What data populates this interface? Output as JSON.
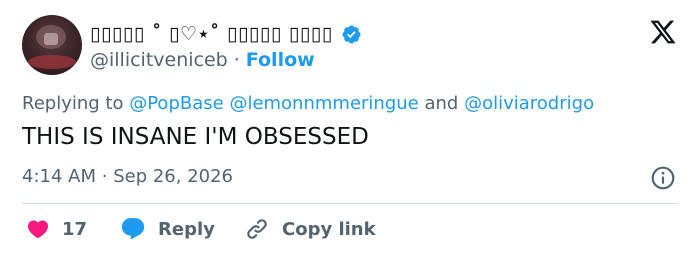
{
  "post": {
    "author": {
      "display_name": "▯▯▯▯▯ ˚ ▯♡⋆˚ ▯▯▯▯▯ ▯▯▯▯",
      "handle": "@illicitveniceb",
      "separator": "·",
      "follow_label": "Follow",
      "verified": true
    },
    "platform_logo": "X",
    "reply_to": {
      "prefix": "Replying to",
      "mention_1": "@PopBase",
      "mention_2": "@lemonnmmeringue",
      "connector": "and",
      "mention_3": "@oliviarodrigo"
    },
    "text": "THIS IS INSANE I'M OBSESSED",
    "meta": {
      "time": "4:14 AM",
      "separator": "·",
      "date": "Sep 26, 2026"
    },
    "actions": {
      "like_count": "17",
      "reply_label": "Reply",
      "copy_label": "Copy link"
    }
  },
  "colors": {
    "accent": "#1d9bf0",
    "like": "#f91880",
    "text": "#0f1419",
    "muted": "#536471",
    "divider": "#cfd9de"
  },
  "icons": [
    "verified-badge-icon",
    "x-logo-icon",
    "info-icon",
    "heart-icon",
    "reply-bubble-icon",
    "link-icon"
  ]
}
